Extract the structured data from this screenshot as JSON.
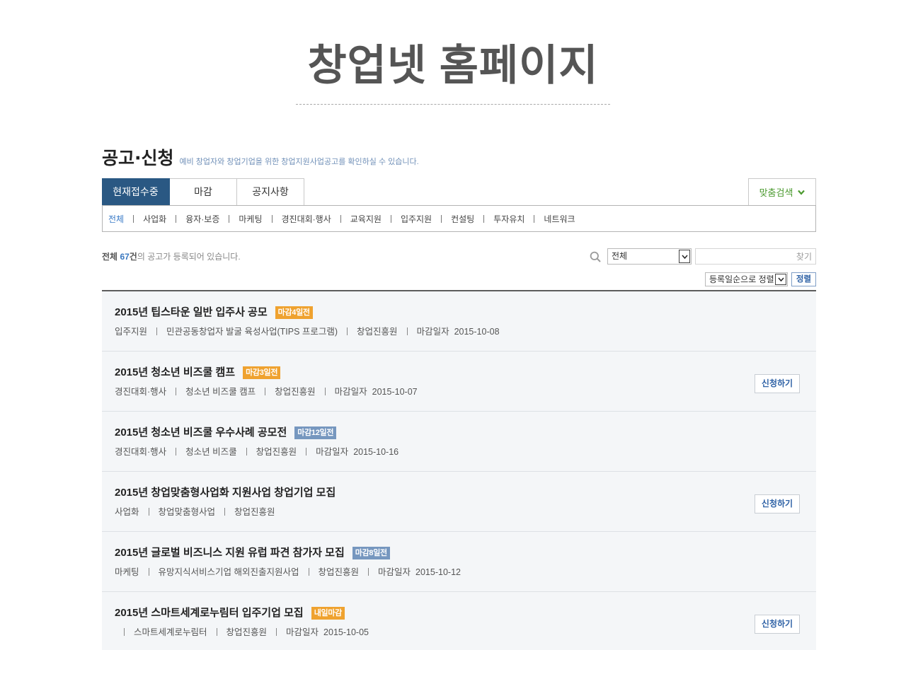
{
  "page_title": "창업넷 홈페이지",
  "section": {
    "title": "공고·신청",
    "subtitle": "예비 창업자와 창업기업을 위한 창업지원사업공고를 확인하실 수 있습니다."
  },
  "tabs": [
    {
      "label": "현재접수중",
      "active": true
    },
    {
      "label": "마감",
      "active": false
    },
    {
      "label": "공지사항",
      "active": false
    }
  ],
  "custom_search": {
    "label": "맞춤검색",
    "icon": "chevron-down-icon"
  },
  "categories": [
    {
      "label": "전체",
      "active": true
    },
    {
      "label": "사업화",
      "active": false
    },
    {
      "label": "융자·보증",
      "active": false
    },
    {
      "label": "마케팅",
      "active": false
    },
    {
      "label": "경진대회·행사",
      "active": false
    },
    {
      "label": "교육지원",
      "active": false
    },
    {
      "label": "입주지원",
      "active": false
    },
    {
      "label": "컨설팅",
      "active": false
    },
    {
      "label": "투자유치",
      "active": false
    },
    {
      "label": "네트워크",
      "active": false
    }
  ],
  "summary": {
    "total_label": "전체",
    "count": "67",
    "count_unit": "건",
    "text": "의 공고가 등록되어 있습니다."
  },
  "search": {
    "icon": "search-icon",
    "scope_selected": "전체",
    "value": "",
    "placeholder": "찾기"
  },
  "sort": {
    "selected": "등록일순으로 정렬",
    "button_label": "정렬",
    "icon": "chevron-down-icon"
  },
  "announcements": [
    {
      "title": "2015년 팁스타운 일반 입주사 공모",
      "badge": {
        "label": "마감4일전",
        "tone": "orange"
      },
      "category": "입주지원",
      "program": "민관공동창업자 발굴 육성사업(TIPS 프로그램)",
      "organization": "창업진흥원",
      "deadline": {
        "label": "마감일자",
        "date": "2015-10-08"
      }
    },
    {
      "title": "2015년 청소년 비즈쿨 캠프",
      "badge": {
        "label": "마감3일전",
        "tone": "orange"
      },
      "category": "경진대회·행사",
      "program": "청소년 비즈쿨 캠프",
      "organization": "창업진흥원",
      "deadline": {
        "label": "마감일자",
        "date": "2015-10-07"
      },
      "apply_label": "신청하기"
    },
    {
      "title": "2015년 청소년 비즈쿨 우수사례 공모전",
      "badge": {
        "label": "마감12일전",
        "tone": "blue"
      },
      "category": "경진대회·행사",
      "program": "청소년 비즈쿨",
      "organization": "창업진흥원",
      "deadline": {
        "label": "마감일자",
        "date": "2015-10-16"
      }
    },
    {
      "title": "2015년 창업맞춤형사업화 지원사업 창업기업 모집",
      "category": "사업화",
      "program": "창업맞춤형사업",
      "organization": "창업진흥원",
      "apply_label": "신청하기"
    },
    {
      "title": "2015년 글로벌 비즈니스 지원 유럽 파견 참가자 모집",
      "badge": {
        "label": "마감8일전",
        "tone": "blue"
      },
      "category": "마케팅",
      "program": "유망지식서비스기업 해외진출지원사업",
      "organization": "창업진흥원",
      "deadline": {
        "label": "마감일자",
        "date": "2015-10-12"
      }
    },
    {
      "title": "2015년 스마트세계로누림터 입주기업 모집",
      "badge": {
        "label": "내일마감",
        "tone": "orange"
      },
      "category": "",
      "program": "스마트세계로누림터",
      "organization": "창업진흥원",
      "deadline": {
        "label": "마감일자",
        "date": "2015-10-05"
      },
      "apply_label": "신청하기"
    }
  ],
  "colors": {
    "primary": "#2a5883",
    "category_active": "#3c7cc8",
    "count_highlight": "#3a78c0",
    "subtitle": "#7090b8",
    "badge_orange": "#efa22f",
    "badge_blue": "#7697bf",
    "custom_search": "#4b9a2f",
    "apply_text": "#2f62a6",
    "list_bg": "#f4f6f8",
    "page_title_text": "#555555"
  }
}
